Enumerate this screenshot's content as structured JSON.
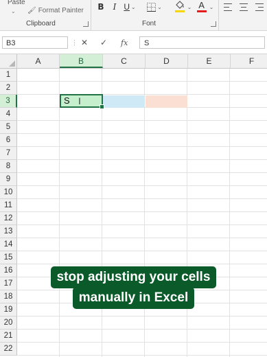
{
  "ribbon": {
    "clipboard": {
      "paste_label": "Paste",
      "format_painter_label": "Format Painter",
      "group_label": "Clipboard"
    },
    "font": {
      "bold": "B",
      "italic": "I",
      "underline": "U",
      "group_label": "Font"
    }
  },
  "formula_bar": {
    "name_box": "B3",
    "cancel": "✕",
    "enter": "✓",
    "fx": "fx",
    "content": "S"
  },
  "sheet": {
    "columns": [
      "A",
      "B",
      "C",
      "D",
      "E",
      "F"
    ],
    "rows": [
      "1",
      "2",
      "3",
      "4",
      "5",
      "6",
      "7",
      "8",
      "9",
      "10",
      "11",
      "12",
      "13",
      "14",
      "15",
      "16",
      "17",
      "18",
      "19",
      "20",
      "21",
      "22"
    ],
    "active_cell_text": "S",
    "fill_colors": {
      "B3": "#c6efce",
      "C3": "#cfe9f7",
      "D3": "#fadfd2"
    }
  },
  "caption": {
    "line1": "stop adjusting your cells",
    "line2": "manually in Excel"
  },
  "colors": {
    "accent": "#217346",
    "caption_bg": "#0b5a2a"
  }
}
